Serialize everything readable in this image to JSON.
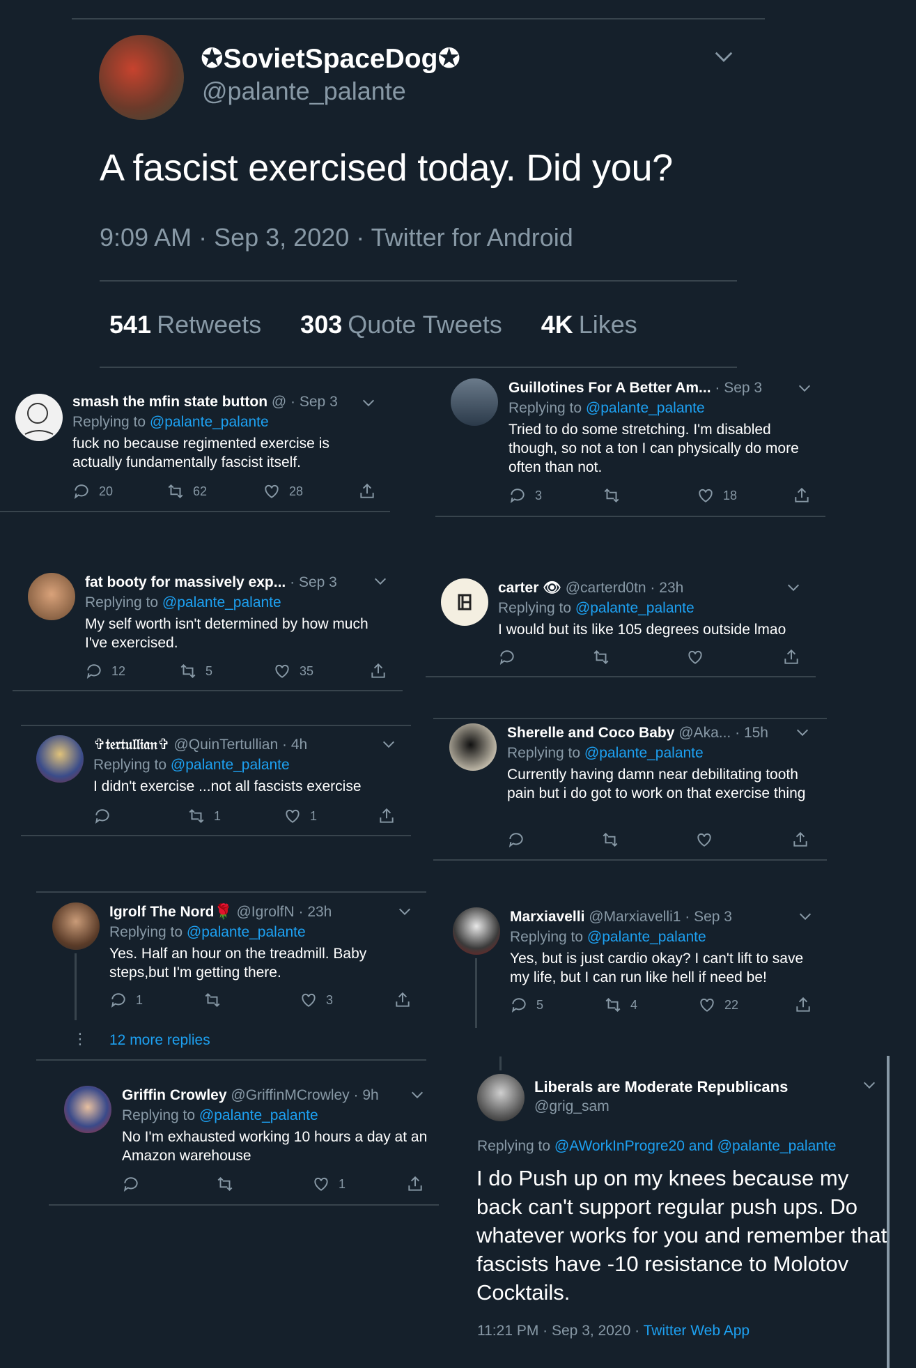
{
  "main": {
    "display_name": "✪SovietSpaceDog✪",
    "handle": "@palante_palante",
    "text": "A fascist exercised today. Did you?",
    "time": "9:09 AM",
    "date": "Sep 3, 2020",
    "source": "Twitter for Android",
    "stats": {
      "retweets_count": "541",
      "retweets_label": "Retweets",
      "quotes_count": "303",
      "quotes_label": "Quote Tweets",
      "likes_count": "4K",
      "likes_label": "Likes"
    }
  },
  "replying_label": "Replying to",
  "replies": [
    {
      "name": "smash the mfin state button",
      "handle": "@",
      "time": "Sep 3",
      "replying_to": "@palante_palante",
      "text": "fuck no because regimented exercise is actually fundamentally fascist itself.",
      "reply_count": "20",
      "retweet_count": "62",
      "like_count": "28"
    },
    {
      "name": "Guillotines For A Better Am...",
      "handle": "",
      "time": "Sep 3",
      "replying_to": "@palante_palante",
      "text": "Tried to do some stretching. I'm disabled though, so not a ton I can physically do more often than not.",
      "reply_count": "3",
      "retweet_count": "",
      "like_count": "18"
    },
    {
      "name": "fat booty for massively exp...",
      "handle": "",
      "time": "Sep 3",
      "replying_to": "@palante_palante",
      "text": "My self worth isn't determined by how much I've exercised.",
      "reply_count": "12",
      "retweet_count": "5",
      "like_count": "35"
    },
    {
      "name": "carter 👁",
      "handle": "@carterd0tn",
      "time": "23h",
      "replying_to": "@palante_palante",
      "text": "I would but its like 105 degrees outside lmao",
      "reply_count": "",
      "retweet_count": "",
      "like_count": ""
    },
    {
      "name": "✞𝔱𝔢𝔯𝔱𝔲𝔩𝔩𝔦𝔞𝔫✞",
      "handle": "@QuinTertullian",
      "time": "4h",
      "replying_to": "@palante_palante",
      "text": "I didn't exercise ...not all fascists exercise",
      "reply_count": "",
      "retweet_count": "1",
      "like_count": "1"
    },
    {
      "name": "Sherelle and Coco Baby",
      "handle": "@Aka...",
      "time": "15h",
      "replying_to": "@palante_palante",
      "text": "Currently having damn near debilitating tooth pain but i do got to work on that exercise thing",
      "reply_count": "",
      "retweet_count": "",
      "like_count": ""
    },
    {
      "name": "Igrolf The Nord🌹",
      "handle": "@IgrolfN",
      "time": "23h",
      "replying_to": "@palante_palante",
      "text": "Yes. Half an hour on the treadmill. Baby steps,but I'm getting there.",
      "reply_count": "1",
      "retweet_count": "",
      "like_count": "3"
    },
    {
      "name": "Marxiavelli",
      "handle": "@Marxiavelli1",
      "time": "Sep 3",
      "replying_to": "@palante_palante",
      "text": "Yes, but is just cardio okay? I can't lift to save my life, but I can run like hell if need be!",
      "reply_count": "5",
      "retweet_count": "4",
      "like_count": "22"
    },
    {
      "name": "Griffin Crowley",
      "handle": "@GriffinMCrowley",
      "time": "9h",
      "replying_to": "@palante_palante",
      "text": "No I'm exhausted working 10 hours a day at an Amazon warehouse",
      "reply_count": "",
      "retweet_count": "",
      "like_count": "1"
    }
  ],
  "more_replies": "12 more replies",
  "big": {
    "name": "Liberals are Moderate Republicans",
    "handle": "@grig_sam",
    "replying_to": "@AWorkInProgre20 and @palante_palante",
    "text": "I do Push up on my knees because my back can't support regular push ups. Do whatever works for you and remember that fascists have -10 resistance to Molotov Cocktails.",
    "time": "11:21 PM",
    "date": "Sep 3, 2020",
    "source": "Twitter Web App"
  },
  "colors": {
    "background": "#15202b",
    "text": "#ffffff",
    "muted": "#8899a6",
    "link": "#1da1f2",
    "divider": "#38444d"
  }
}
